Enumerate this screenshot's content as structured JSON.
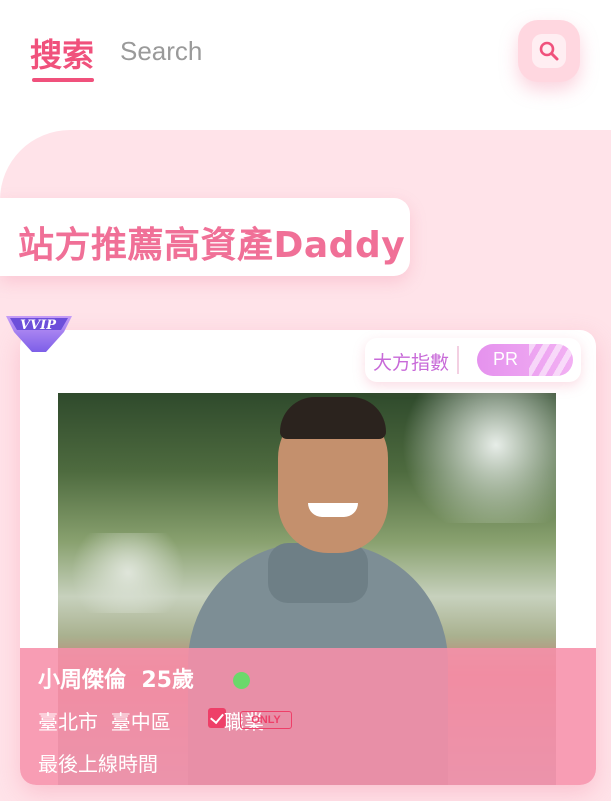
{
  "header": {
    "tab_active": "搜索",
    "tab_inactive": "Search",
    "search_icon": "search-icon"
  },
  "banner": {
    "title": "站方推薦高資產Daddy"
  },
  "card": {
    "vip_label": "VVIP",
    "generosity_label": "大方指數",
    "pr_label": "PR",
    "name": "小周傑倫",
    "age": "25歲",
    "online": true,
    "city": "臺北市",
    "district": "臺中區",
    "badge_text": "職業",
    "badge_only": "ONLY",
    "last_online": "最後上線時間"
  },
  "colors": {
    "accent": "#f0517c",
    "banner_text": "#f07097",
    "panel": "#ffe3e9",
    "info_overlay": "#f78faa",
    "online_dot": "#6bd86b"
  }
}
